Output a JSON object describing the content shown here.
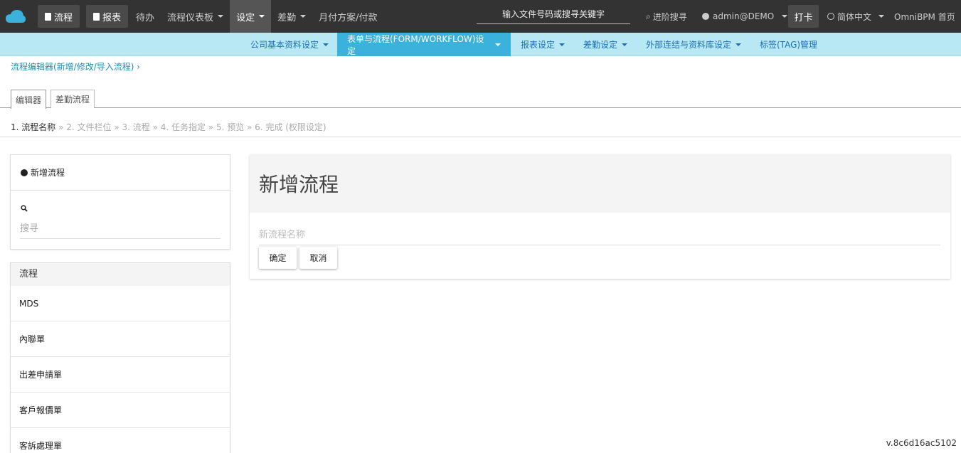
{
  "topbar": {
    "logo_icon": "cloud-icon",
    "btn_process": "流程",
    "btn_report": "报表",
    "nav": [
      "待办",
      "流程仪表板",
      "设定",
      "差勤",
      "月付方案/付款"
    ],
    "search_placeholder": "输入文件号码或搜寻关键字",
    "advanced_search": "进阶搜寻",
    "user": "admin@DEMO",
    "clock_in": "打卡",
    "language": "简体中文",
    "home": "OmniBPM 首页"
  },
  "subnav": [
    "公司基本资料设定",
    "表单与流程(FORM/WORKFLOW)设定",
    "报表设定",
    "差勤设定",
    "外部连结与资料库设定",
    "标签(TAG)管理"
  ],
  "breadcrumb": "流程编辑器(新增/修改/导入流程) ›",
  "tabs": [
    "编辑器",
    "差勤流程"
  ],
  "steps": {
    "current": "1. 流程名称",
    "rest": " » 2. 文件栏位 » 3. 流程 » 4. 任务指定 » 5. 预览 » 6. 完成 (权限设定)"
  },
  "left": {
    "new_flow": "新增流程",
    "search_placeholder": "搜寻",
    "list_header": "流程",
    "items": [
      "MDS",
      "內聯單",
      "出差申請單",
      "客戶報價單",
      "客訴處理單"
    ]
  },
  "main": {
    "title": "新增流程",
    "name_placeholder": "新流程名称",
    "ok": "确定",
    "cancel": "取消"
  },
  "version": "v.8c6d16ac5102",
  "colors": {
    "topbar": "#333333",
    "subnav": "#b9e8f5",
    "subnav_active": "#3ab2dc"
  }
}
